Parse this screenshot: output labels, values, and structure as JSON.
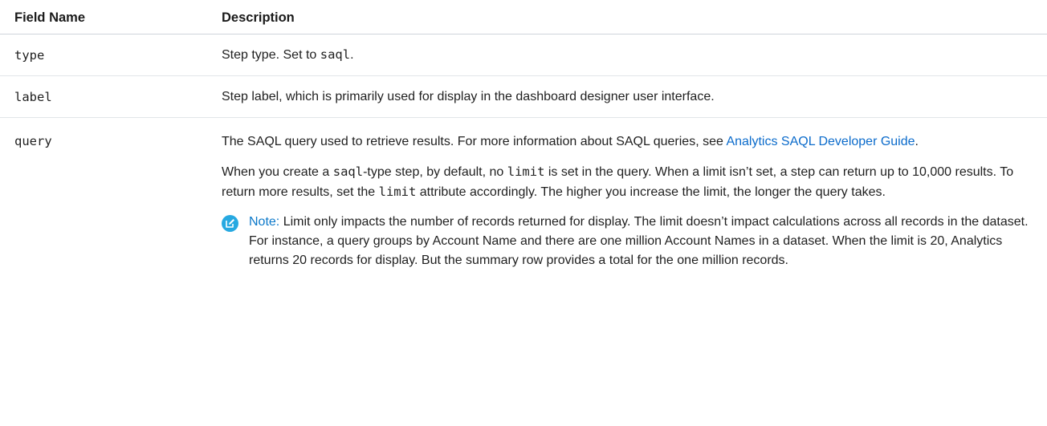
{
  "header": {
    "field_name": "Field Name",
    "description": "Description"
  },
  "rows": {
    "type": {
      "name": "type",
      "desc_text": "Step type. Set to ",
      "desc_code": "saql",
      "desc_end": "."
    },
    "label": {
      "name": "label",
      "desc": "Step label, which is primarily used for display in the dashboard designer user interface."
    },
    "query": {
      "name": "query",
      "p1_text": "The SAQL query used to retrieve results. For more information about SAQL queries, see ",
      "p1_link": "Analytics SAQL Developer Guide",
      "p1_end": ".",
      "p2_a": "When you create a ",
      "p2_code1": "saql",
      "p2_b": "-type step, by default, no ",
      "p2_code2": "limit",
      "p2_c": " is set in the query. When a limit isn’t set, a step can return up to 10,000 results. To return more results, set the ",
      "p2_code3": "limit",
      "p2_d": " attribute accordingly. The higher you increase the limit, the longer the query takes.",
      "note_label": "Note:",
      "note_text": " Limit only impacts the number of records returned for display. The limit doesn’t impact calculations across all records in the dataset. For instance, a query groups by Account Name and there are one million Account Names in a dataset. When the limit is 20, Analytics returns 20 records for display. But the summary row provides a total for the one million records."
    }
  },
  "colors": {
    "link": "#0b6bcb",
    "note_icon": "#27a9e1",
    "note_label": "#0b78c9"
  },
  "icons": {
    "note": "edit-note-icon"
  }
}
